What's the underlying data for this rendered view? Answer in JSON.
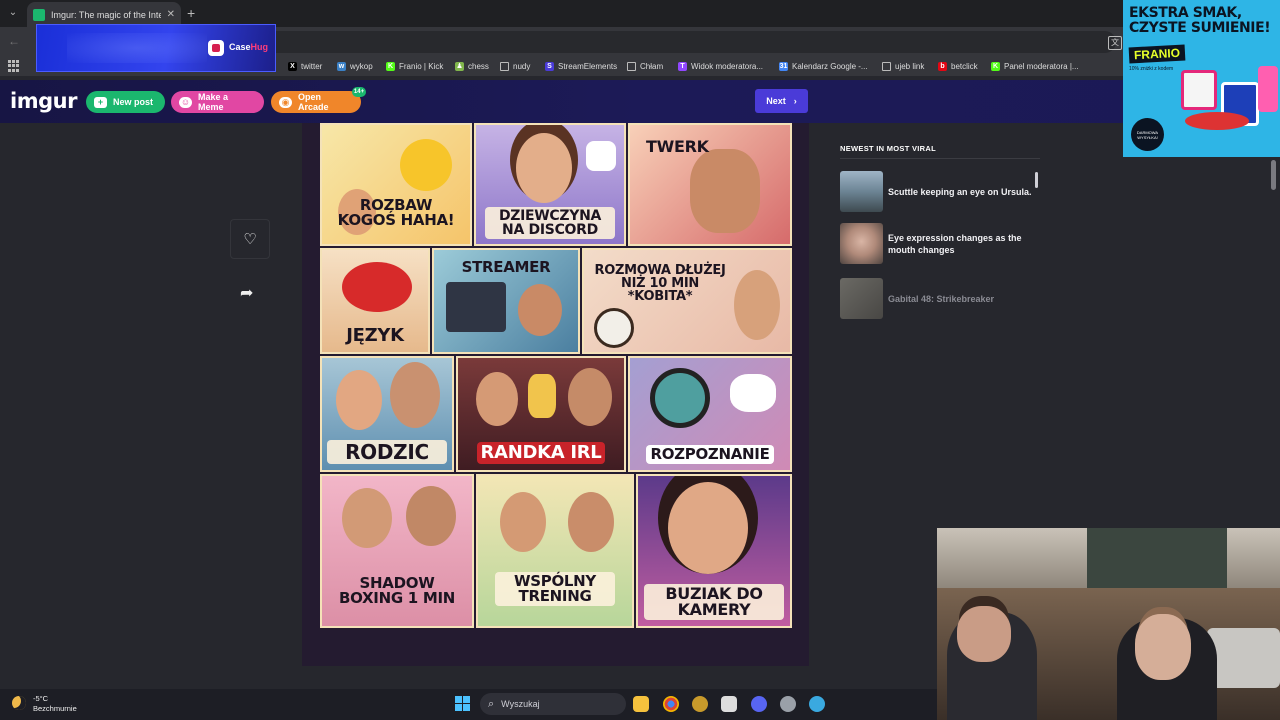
{
  "browser": {
    "tab_title": "Imgur: The magic of the Internet",
    "tab_close": "✕",
    "new_tab": "+",
    "tab_menu": "⌄",
    "back": "←",
    "translate_glyph": "文",
    "star": "☆",
    "bookmarks": [
      {
        "label": "twitter",
        "color": "#000000",
        "glyph": "X"
      },
      {
        "label": "wykop",
        "color": "#3a80c6",
        "glyph": "w"
      },
      {
        "label": "Franio | Kick",
        "color": "#53fc18",
        "glyph": "K"
      },
      {
        "label": "chess",
        "color": "#81b64c",
        "glyph": "♟"
      },
      {
        "label": "nudy",
        "color": "#8a8a8a",
        "glyph": ""
      },
      {
        "label": "StreamElements",
        "color": "#4a3bd8",
        "glyph": "S"
      },
      {
        "label": "Chłam",
        "color": "#8a8a8a",
        "glyph": ""
      },
      {
        "label": "Widok moderatora...",
        "color": "#9147ff",
        "glyph": "T"
      },
      {
        "label": "Kalendarz Google -...",
        "color": "#4285f4",
        "glyph": "31"
      },
      {
        "label": "ujeb link",
        "color": "#8a8a8a",
        "glyph": ""
      },
      {
        "label": "betclick",
        "color": "#e30613",
        "glyph": "b"
      },
      {
        "label": "Panel moderatora |...",
        "color": "#53fc18",
        "glyph": "K"
      }
    ]
  },
  "casehug_ad": {
    "brand_main": "Case",
    "brand_accent": "Hug"
  },
  "franio_ad": {
    "headline": "EKSTRA SMAK, CZYSTE SUMIENIE!",
    "brand": "FRANIO",
    "note": "10% zniżki z kodem",
    "badge": "DARMOWA WYSYŁKA!"
  },
  "header": {
    "logo": "imgur",
    "new_post": "New post",
    "make_meme": "Make a Meme",
    "open_arcade": "Open Arcade",
    "arcade_badge": "14+",
    "next": "Next",
    "new_post_glyph": "+",
    "meme_glyph": "☺",
    "arcade_glyph": "◉",
    "next_glyph": "›"
  },
  "actions": {
    "favorite_glyph": "♡",
    "share_glyph": "➦"
  },
  "post": {
    "panels": [
      {
        "label": "ROZBAW KOGOŚ HAHA!"
      },
      {
        "label": "DZIEWCZYNA NA DISCORD"
      },
      {
        "label": "TWERK"
      },
      {
        "label": "JĘZYK"
      },
      {
        "label": "STREAMER"
      },
      {
        "label": "ROZMOWA DŁUŻEJ NIŻ 10 MIN *KOBITA*"
      },
      {
        "label": "RODZIC"
      },
      {
        "label": "RANDKA IRL"
      },
      {
        "label": "ROZPOZNANIE"
      },
      {
        "label": "SHADOW BOXING 1 MIN"
      },
      {
        "label": "WSPÓLNY TRENING"
      },
      {
        "label": "BUZIAK DO KAMERY"
      }
    ]
  },
  "sidebar": {
    "heading": "NEWEST IN MOST VIRAL",
    "items": [
      {
        "title": "Scuttle keeping an eye on Ursula."
      },
      {
        "title": "Eye expression changes as the mouth changes"
      },
      {
        "title": "Gabital 48: Strikebreaker"
      }
    ]
  },
  "taskbar": {
    "temperature": "-5°C",
    "condition": "Bezchmurnie",
    "search_placeholder": "Wyszukaj",
    "search_glyph": "⌕"
  }
}
